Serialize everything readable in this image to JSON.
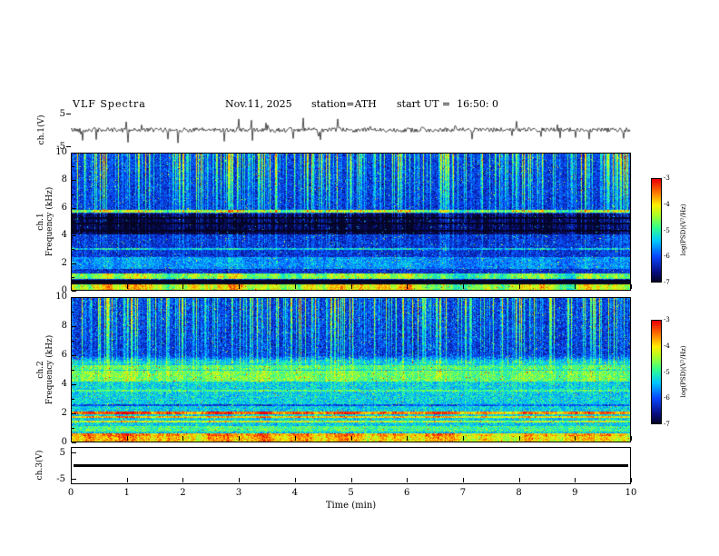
{
  "header": {
    "title": "VLF Spectra",
    "date": "Nov.11, 2025",
    "station": "station=ATH",
    "start_ut": "start UT =  16:50: 0"
  },
  "x_axis": {
    "label": "Time (min)",
    "min": 0,
    "max": 10,
    "ticks": [
      0,
      1,
      2,
      3,
      4,
      5,
      6,
      7,
      8,
      9,
      10
    ]
  },
  "colorbar": {
    "label": "log(PSD)(V²/Hz)",
    "min": -7,
    "max": -3,
    "ticks": [
      -3,
      -4,
      -5,
      -6,
      -7
    ]
  },
  "chart_data": [
    {
      "panel": "ch1-waveform",
      "type": "line",
      "ylabel": "ch.1(V)",
      "ylim": [
        -5,
        5
      ],
      "yticks": [
        5,
        -5
      ],
      "description": "continuous broadband noise trace centered at 0 V with many short impulsive spikes up to about +/-4 V over 0-10 min",
      "gen": {
        "seed": 42,
        "noise_amp": 0.7,
        "spike_prob": 0.05,
        "spike_amp_min": 1.3,
        "spike_amp_max": 3.6
      }
    },
    {
      "panel": "ch1-spectrogram",
      "type": "heatmap",
      "ylabel_line1": "ch.1",
      "ylabel_line2": "Frequency (kHz)",
      "ylim": [
        0,
        10
      ],
      "yticks": [
        0,
        2,
        4,
        6,
        8,
        10
      ],
      "zlim": [
        -7,
        -3
      ],
      "description": "dense vertical sferic streaks strongest above ~6 kHz (green/yellow) over dark blue background; dark absorption band 4.1-5.6 kHz with near-black lines; bright narrow line near 5.8 kHz and 3.0 kHz; enhanced green bands near 1 kHz and 1.6-2.4 kHz; black band 0.45-0.75 kHz; bright green-yellow band below 0.4 kHz",
      "gen": {
        "seed": 7,
        "base_high": -6.25,
        "base_low": -6.25,
        "split_freq": 0,
        "noise": 0.45,
        "streaks": {
          "density": 0.55,
          "strength": 2.7,
          "top_bias": 1.6
        },
        "bands": [
          {
            "f0": 4.1,
            "f1": 5.65,
            "delta": -0.8
          },
          {
            "f0": 4.28,
            "f1": 4.42,
            "delta": -1.3
          },
          {
            "f0": 4.85,
            "f1": 4.98,
            "delta": -1.1
          },
          {
            "f0": 5.25,
            "f1": 5.36,
            "delta": -0.9
          },
          {
            "f0": 5.72,
            "f1": 5.88,
            "delta": 1.5
          },
          {
            "f0": 2.98,
            "f1": 3.1,
            "delta": 0.8
          },
          {
            "f0": 1.55,
            "f1": 2.45,
            "delta": 0.55
          },
          {
            "f0": 0.85,
            "f1": 1.25,
            "delta": 1.6
          },
          {
            "f0": 0.45,
            "f1": 0.75,
            "delta": -3.5
          },
          {
            "f0": 0.05,
            "f1": 0.42,
            "delta": 2.0
          }
        ]
      }
    },
    {
      "panel": "ch2-spectrogram",
      "type": "heatmap",
      "ylabel_line1": "ch.2",
      "ylabel_line2": "Frequency (kHz)",
      "ylim": [
        0,
        10
      ],
      "yticks": [
        0,
        2,
        4,
        6,
        8,
        10
      ],
      "zlim": [
        -7,
        -3
      ],
      "description": "vertical sferic streaks above ~5.5 kHz on dark blue background; broad green/cyan enhancement below ~5.5 kHz with many horizontal lines; strong orange-red lines near 1.4-2.1 kHz and 0.5 kHz; bright yellow-green band below 0.4 kHz; thin dark line near 2.6 kHz",
      "gen": {
        "seed": 19,
        "base_high": -6.25,
        "base_low": -5.35,
        "split_freq": 5.5,
        "noise": 0.5,
        "streaks": {
          "density": 0.5,
          "strength": 2.6,
          "top_bias": 1.4
        },
        "bands": [
          {
            "f0": 5.05,
            "f1": 5.35,
            "delta": 0.5
          },
          {
            "f0": 4.2,
            "f1": 4.95,
            "delta": 0.65
          },
          {
            "f0": 3.5,
            "f1": 3.66,
            "delta": 0.5
          },
          {
            "f0": 2.52,
            "f1": 2.64,
            "delta": -0.7
          },
          {
            "f0": 1.9,
            "f1": 2.15,
            "delta": 1.9
          },
          {
            "f0": 1.66,
            "f1": 1.8,
            "delta": 1.5
          },
          {
            "f0": 1.36,
            "f1": 1.5,
            "delta": 1.1
          },
          {
            "f0": 0.75,
            "f1": 1.1,
            "delta": 0.5
          },
          {
            "f0": 0.44,
            "f1": 0.62,
            "delta": 1.7
          },
          {
            "f0": 0.06,
            "f1": 0.4,
            "delta": 1.5
          }
        ]
      }
    },
    {
      "panel": "ch3-flatline",
      "type": "line",
      "ylabel": "ch.3(V)",
      "ylim": [
        -7,
        7
      ],
      "yticks": [
        5,
        -5
      ],
      "value": 0,
      "description": "dead channel: constant 0 V drawn as a thick black horizontal line across the full 0-10 min window"
    }
  ]
}
